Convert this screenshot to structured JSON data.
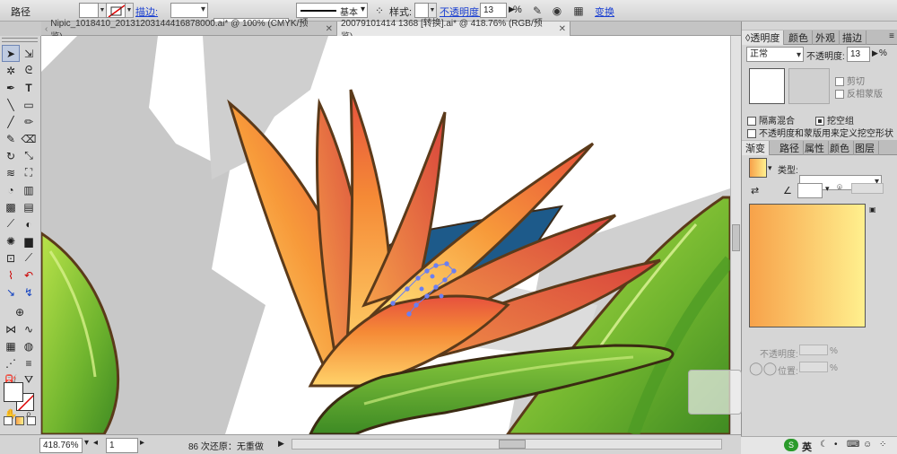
{
  "control_bar": {
    "path_label": "路径",
    "stroke_link": "描边:",
    "stroke_profile": "基本",
    "style_label": "样式:",
    "opacity_link": "不透明度:",
    "opacity_value": "13",
    "opacity_unit": "%",
    "transform_link": "变换"
  },
  "tabs": [
    {
      "label": "Nipic_1018410_20131203144416878000.ai* @ 100% (CMYK/预览)",
      "close": "✕"
    },
    {
      "label": "20079101414 1368 [转换].ai* @ 418.76% (RGB/预览)",
      "close": "✕"
    }
  ],
  "status": {
    "zoom": "418.76%",
    "page": "1",
    "undo_text": "86 次还原：无重做"
  },
  "transparency_panel": {
    "tabs": [
      "◊透明度",
      "颜色",
      "外观",
      "描边"
    ],
    "blend_mode": "正常",
    "opacity_label": "不透明度:",
    "opacity_value": "13",
    "opacity_unit": "%",
    "clip_label": "剪切",
    "invert_mask_label": "反相蒙版",
    "isolate_blend_label": "隔离混合",
    "knockout_group_label": "挖空组",
    "opacity_mask_label": "不透明度和蒙版用来定义挖空形状"
  },
  "gradient_panel": {
    "tabs": [
      "渐变",
      "路径",
      "属性",
      "颜色",
      "图层"
    ],
    "type_label": "类型:",
    "opacity_label": "不透明度:",
    "location_label": "位置:",
    "percent": "%"
  },
  "taskbar": {
    "ime": "英"
  },
  "colors": {
    "gradient_start": "#f7a24a",
    "gradient_end": "#fff08e",
    "accent": "#1a3fd1"
  }
}
